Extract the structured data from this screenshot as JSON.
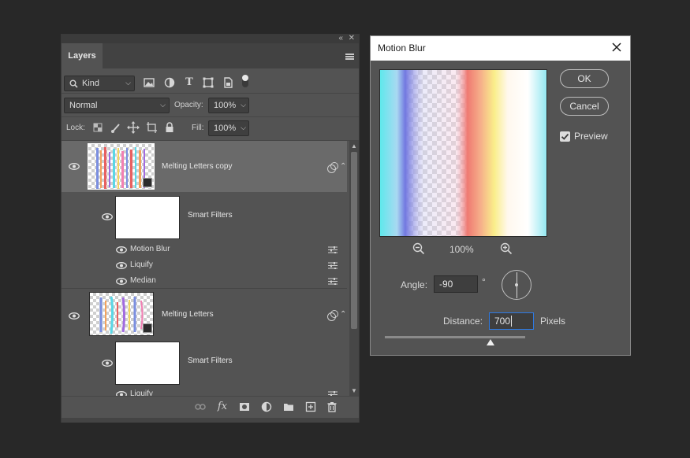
{
  "layers_panel": {
    "tab_label": "Layers",
    "filter_kind": "Kind",
    "blend_mode": "Normal",
    "opacity_label": "Opacity:",
    "opacity_value": "100%",
    "lock_label": "Lock:",
    "fill_label": "Fill:",
    "fill_value": "100%",
    "layers": [
      {
        "name": "Melting Letters copy",
        "selected": true,
        "smart_filters_label": "Smart Filters",
        "filters": [
          "Motion Blur",
          "Liquify",
          "Median"
        ]
      },
      {
        "name": "Melting Letters",
        "selected": false,
        "smart_filters_label": "Smart Filters",
        "filters": [
          "Liquify"
        ]
      }
    ],
    "bottom_icons": [
      "link-icon",
      "fx-icon",
      "mask-icon",
      "adjustment-icon",
      "folder-icon",
      "new-layer-icon",
      "trash-icon"
    ]
  },
  "dialog": {
    "title": "Motion Blur",
    "ok_label": "OK",
    "cancel_label": "Cancel",
    "preview_label": "Preview",
    "preview_checked": true,
    "zoom_level": "100%",
    "angle_label": "Angle:",
    "angle_value": "-90",
    "angle_unit": "°",
    "distance_label": "Distance:",
    "distance_value": "700",
    "distance_unit": "Pixels",
    "distance_slider_fraction": 0.75
  },
  "colors": {
    "panel_bg": "#535353",
    "app_bg": "#282828",
    "selected_row": "#6a6a6a",
    "focus_blue": "#2d7be6"
  }
}
